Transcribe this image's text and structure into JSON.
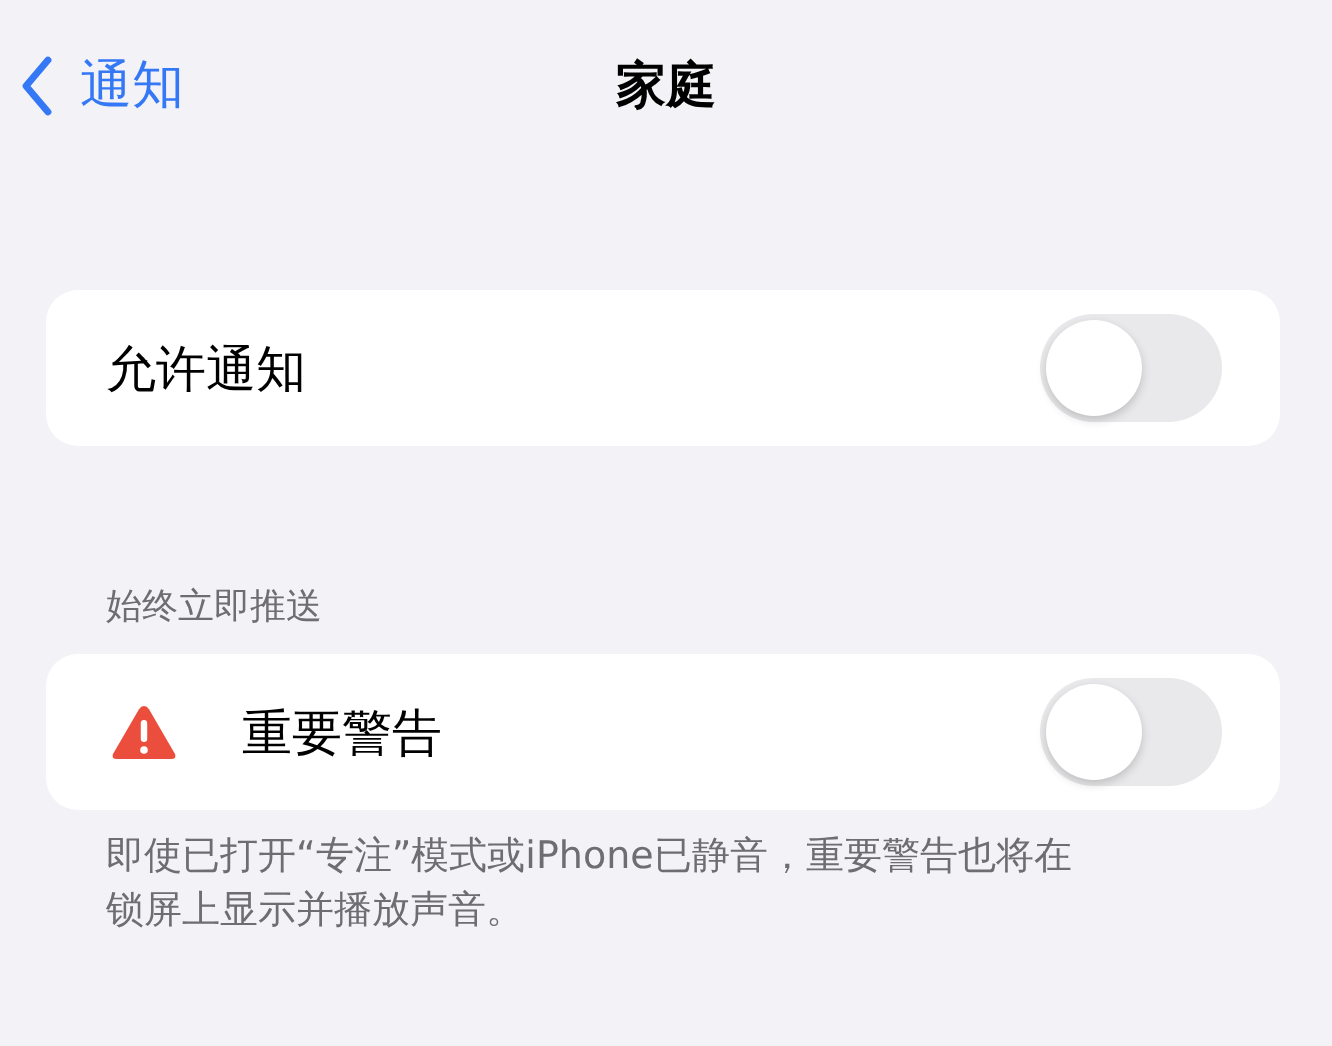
{
  "nav": {
    "back": "通知",
    "title": "家庭"
  },
  "sections": [
    {
      "rows": [
        {
          "kind": "plain",
          "label": "允许通知",
          "on": false
        }
      ]
    },
    {
      "header": "始终立即推送",
      "rows": [
        {
          "kind": "warning",
          "label": "重要警告",
          "on": false
        }
      ],
      "footer": "即使已打开“专注”模式或iPhone已静音，重要警告也将在锁屏上显示并播放声音。"
    }
  ]
}
